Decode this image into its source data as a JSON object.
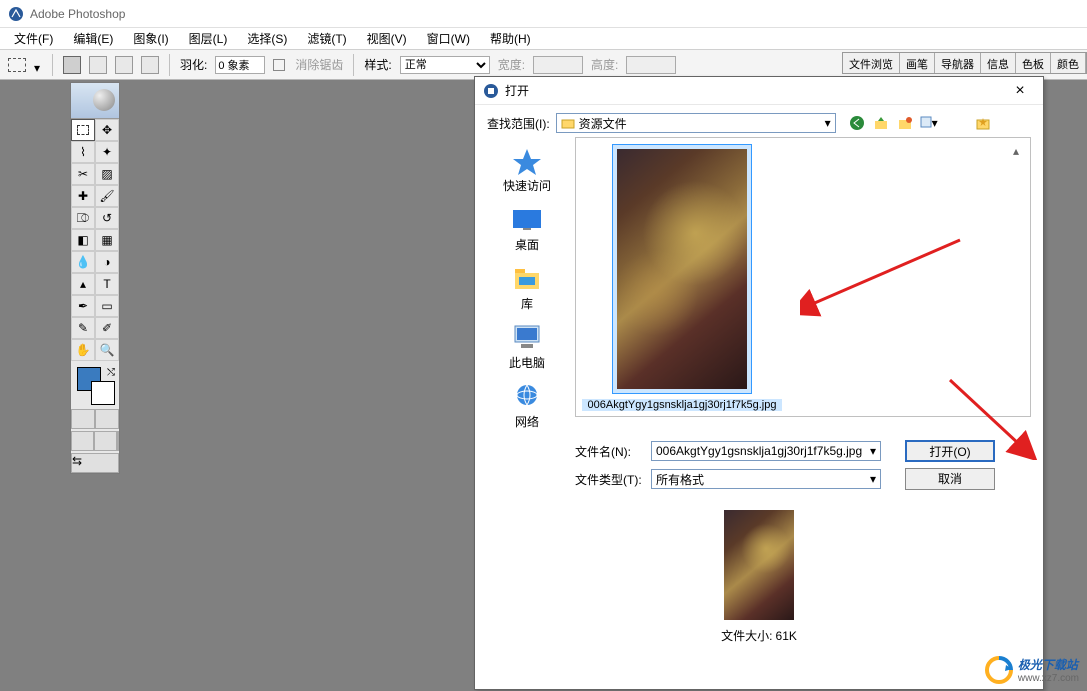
{
  "app": {
    "title": "Adobe Photoshop"
  },
  "menu": {
    "file": "文件(F)",
    "edit": "编辑(E)",
    "image": "图象(I)",
    "layer": "图层(L)",
    "select": "选择(S)",
    "filter": "滤镜(T)",
    "view": "视图(V)",
    "window": "窗口(W)",
    "help": "帮助(H)"
  },
  "options": {
    "feather_label": "羽化:",
    "feather_value": "0 象素",
    "antialias": "消除锯齿",
    "style_label": "样式:",
    "style_value": "正常",
    "width_label": "宽度:",
    "height_label": "高度:"
  },
  "panels": [
    "文件浏览",
    "画笔",
    "导航器",
    "信息",
    "色板",
    "颜色"
  ],
  "dialog": {
    "title": "打开",
    "lookin_label": "查找范围(I):",
    "lookin_value": "资源文件",
    "places": {
      "quick": "快速访问",
      "desktop": "桌面",
      "library": "库",
      "thispc": "此电脑",
      "network": "网络"
    },
    "selected_file": "006AkgtYgy1gsnsklja1gj30rj1f7k5g.jpg",
    "filename_label": "文件名(N):",
    "filename_value": "006AkgtYgy1gsnsklja1gj30rj1f7k5g.jpg",
    "filetype_label": "文件类型(T):",
    "filetype_value": "所有格式",
    "open_btn": "打开(O)",
    "cancel_btn": "取消",
    "filesize_label": "文件大小:",
    "filesize_value": "61K"
  },
  "watermark": {
    "brand": "极光下载站",
    "url": "www.xz7.com"
  }
}
